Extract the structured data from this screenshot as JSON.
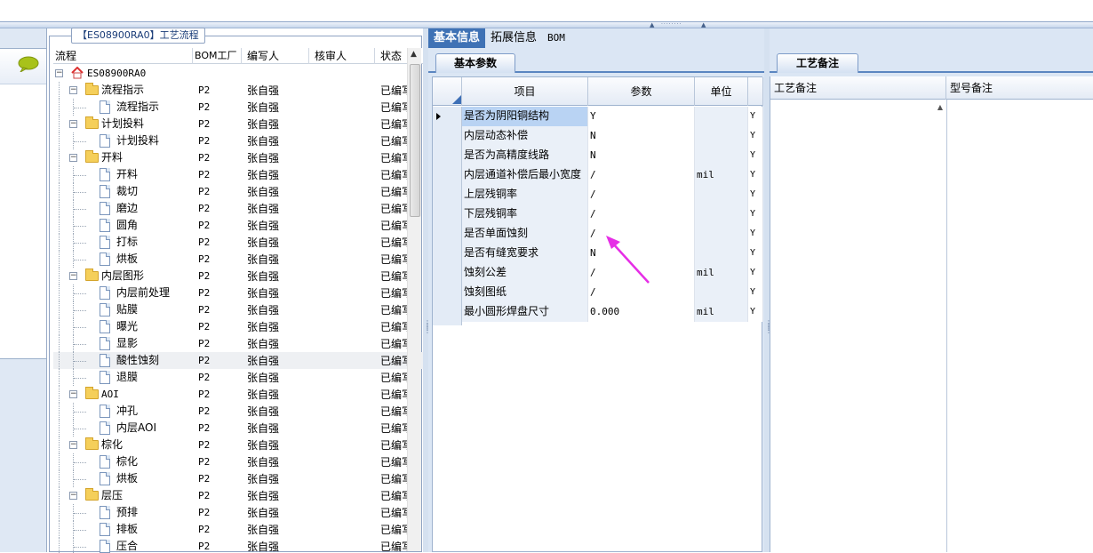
{
  "window": {
    "grip_label": "········"
  },
  "tree_panel": {
    "title": "【ES08900RA0】工艺流程",
    "columns": [
      "流程",
      "BOM工厂",
      "编写人",
      "核审人",
      "状态"
    ],
    "rows": [
      {
        "level": 0,
        "type": "root",
        "name": "ES08900RA0",
        "bom": "",
        "writer": "",
        "reviewer": "",
        "status": ""
      },
      {
        "level": 1,
        "type": "folder",
        "name": "流程指示",
        "bom": "P2",
        "writer": "张自强",
        "reviewer": "",
        "status": "已编写"
      },
      {
        "level": 2,
        "type": "doc",
        "name": "流程指示",
        "bom": "P2",
        "writer": "张自强",
        "reviewer": "",
        "status": "已编写"
      },
      {
        "level": 1,
        "type": "folder",
        "name": "计划投料",
        "bom": "P2",
        "writer": "张自强",
        "reviewer": "",
        "status": "已编写"
      },
      {
        "level": 2,
        "type": "doc",
        "name": "计划投料",
        "bom": "P2",
        "writer": "张自强",
        "reviewer": "",
        "status": "已编写"
      },
      {
        "level": 1,
        "type": "folder",
        "name": "开料",
        "bom": "P2",
        "writer": "张自强",
        "reviewer": "",
        "status": "已编写"
      },
      {
        "level": 2,
        "type": "doc",
        "name": "开料",
        "bom": "P2",
        "writer": "张自强",
        "reviewer": "",
        "status": "已编写"
      },
      {
        "level": 2,
        "type": "doc",
        "name": "裁切",
        "bom": "P2",
        "writer": "张自强",
        "reviewer": "",
        "status": "已编写"
      },
      {
        "level": 2,
        "type": "doc",
        "name": "磨边",
        "bom": "P2",
        "writer": "张自强",
        "reviewer": "",
        "status": "已编写"
      },
      {
        "level": 2,
        "type": "doc",
        "name": "圆角",
        "bom": "P2",
        "writer": "张自强",
        "reviewer": "",
        "status": "已编写"
      },
      {
        "level": 2,
        "type": "doc",
        "name": "打标",
        "bom": "P2",
        "writer": "张自强",
        "reviewer": "",
        "status": "已编写"
      },
      {
        "level": 2,
        "type": "doc",
        "name": "烘板",
        "bom": "P2",
        "writer": "张自强",
        "reviewer": "",
        "status": "已编写"
      },
      {
        "level": 1,
        "type": "folder",
        "name": "内层图形",
        "bom": "P2",
        "writer": "张自强",
        "reviewer": "",
        "status": "已编写"
      },
      {
        "level": 2,
        "type": "doc",
        "name": "内层前处理",
        "bom": "P2",
        "writer": "张自强",
        "reviewer": "",
        "status": "已编写"
      },
      {
        "level": 2,
        "type": "doc",
        "name": "贴膜",
        "bom": "P2",
        "writer": "张自强",
        "reviewer": "",
        "status": "已编写"
      },
      {
        "level": 2,
        "type": "doc",
        "name": "曝光",
        "bom": "P2",
        "writer": "张自强",
        "reviewer": "",
        "status": "已编写"
      },
      {
        "level": 2,
        "type": "doc",
        "name": "显影",
        "bom": "P2",
        "writer": "张自强",
        "reviewer": "",
        "status": "已编写"
      },
      {
        "level": 2,
        "type": "doc",
        "name": "酸性蚀刻",
        "bom": "P2",
        "writer": "张自强",
        "reviewer": "",
        "status": "已编写",
        "selected": true
      },
      {
        "level": 2,
        "type": "doc",
        "name": "退膜",
        "bom": "P2",
        "writer": "张自强",
        "reviewer": "",
        "status": "已编写"
      },
      {
        "level": 1,
        "type": "folder",
        "name": "AOI",
        "bom": "P2",
        "writer": "张自强",
        "reviewer": "",
        "status": "已编写"
      },
      {
        "level": 2,
        "type": "doc",
        "name": "冲孔",
        "bom": "P2",
        "writer": "张自强",
        "reviewer": "",
        "status": "已编写"
      },
      {
        "level": 2,
        "type": "doc",
        "name": "内层AOI",
        "bom": "P2",
        "writer": "张自强",
        "reviewer": "",
        "status": "已编写"
      },
      {
        "level": 1,
        "type": "folder",
        "name": "棕化",
        "bom": "P2",
        "writer": "张自强",
        "reviewer": "",
        "status": "已编写"
      },
      {
        "level": 2,
        "type": "doc",
        "name": "棕化",
        "bom": "P2",
        "writer": "张自强",
        "reviewer": "",
        "status": "已编写"
      },
      {
        "level": 2,
        "type": "doc",
        "name": "烘板",
        "bom": "P2",
        "writer": "张自强",
        "reviewer": "",
        "status": "已编写"
      },
      {
        "level": 1,
        "type": "folder",
        "name": "层压",
        "bom": "P2",
        "writer": "张自强",
        "reviewer": "",
        "status": "已编写"
      },
      {
        "level": 2,
        "type": "doc",
        "name": "预排",
        "bom": "P2",
        "writer": "张自强",
        "reviewer": "",
        "status": "已编写"
      },
      {
        "level": 2,
        "type": "doc",
        "name": "排板",
        "bom": "P2",
        "writer": "张自强",
        "reviewer": "",
        "status": "已编写"
      },
      {
        "level": 2,
        "type": "doc",
        "name": "压合",
        "bom": "P2",
        "writer": "张自强",
        "reviewer": "",
        "status": "已编写"
      }
    ]
  },
  "middle_panel": {
    "tabs": [
      {
        "label": "基本信息",
        "active": true
      },
      {
        "label": "拓展信息",
        "active": false
      },
      {
        "label": "BOM",
        "active": false
      }
    ],
    "subtab": "基本参数",
    "grid_columns": [
      "项目",
      "参数",
      "单位"
    ],
    "grid_rows": [
      {
        "item": "是否为阴阳铜结构",
        "param": "Y",
        "unit": "",
        "extra": "Y",
        "current": true
      },
      {
        "item": "内层动态补偿",
        "param": "N",
        "unit": "",
        "extra": "Y"
      },
      {
        "item": "是否为高精度线路",
        "param": "N",
        "unit": "",
        "extra": "Y"
      },
      {
        "item": "内层通道补偿后最小宽度",
        "param": "/",
        "unit": "mil",
        "extra": "Y"
      },
      {
        "item": "上层残铜率",
        "param": "/",
        "unit": "",
        "extra": "Y"
      },
      {
        "item": "下层残铜率",
        "param": "/",
        "unit": "",
        "extra": "Y"
      },
      {
        "item": "是否单面蚀刻",
        "param": "/",
        "unit": "",
        "extra": "Y"
      },
      {
        "item": "是否有缝宽要求",
        "param": "N",
        "unit": "",
        "extra": "Y"
      },
      {
        "item": "蚀刻公差",
        "param": "/",
        "unit": "mil",
        "extra": "Y"
      },
      {
        "item": "蚀刻图纸",
        "param": "/",
        "unit": "",
        "extra": "Y"
      },
      {
        "item": "最小圆形焊盘尺寸",
        "param": "0.000",
        "unit": "mil",
        "extra": "Y"
      }
    ]
  },
  "right_panel": {
    "tab": "工艺备注",
    "columns": [
      "工艺备注",
      "型号备注"
    ]
  },
  "annotation": {
    "arrow_color": "#e62ee6"
  }
}
